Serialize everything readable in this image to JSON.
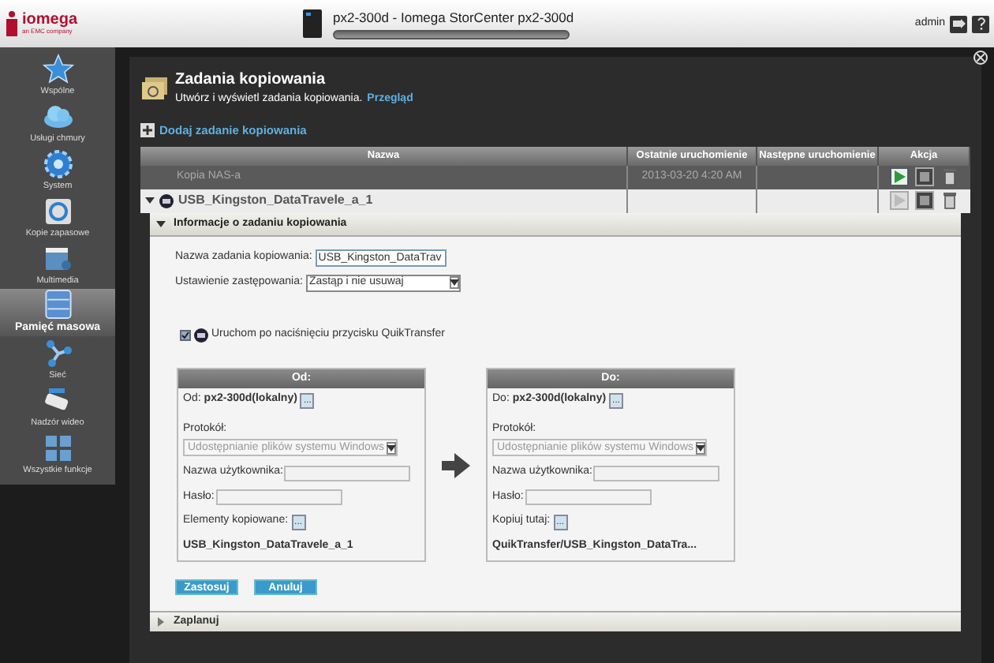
{
  "header": {
    "logo": "iomega",
    "tagline": "an EMC company",
    "device_title": "px2-300d - Iomega StorCenter px2-300d",
    "user": "admin"
  },
  "sidebar": {
    "items": [
      {
        "label": "Wspólne",
        "selected": false
      },
      {
        "label": "Usługi chmury",
        "selected": false
      },
      {
        "label": "System",
        "selected": false
      },
      {
        "label": "Kopie zapasowe",
        "selected": false
      },
      {
        "label": "Multimedia",
        "selected": false
      },
      {
        "label": "Pamięć masowa",
        "selected": true
      },
      {
        "label": "Sieć",
        "selected": false
      },
      {
        "label": "Nadzór wideo",
        "selected": false
      },
      {
        "label": "Wszystkie funkcje",
        "selected": false
      }
    ]
  },
  "page": {
    "title": "Zadania kopiowania",
    "subtitle": "Utwórz i wyświetl zadania kopiowania.",
    "link": "Przegląd",
    "add_link": "Dodaj zadanie kopiowania"
  },
  "table": {
    "columns": [
      "Nazwa",
      "Ostatnie uruchomienie",
      "Następne uruchomienie",
      "Akcja"
    ],
    "rows": [
      {
        "kind": "plain",
        "name": "Kopia NAS-a",
        "last_run": "2013-03-20 4:20 AM",
        "play_enabled": true
      },
      {
        "kind": "expandable",
        "expanded": true,
        "name": "USB_Kingston_DataTravele_a_1",
        "play_enabled": false
      }
    ]
  },
  "details": {
    "title": "Informacje o zadaniu kopiowania",
    "expanded": true,
    "name_label": "Nazwa zadania kopiowania:",
    "name_value": "USB_Kingston_DataTrav",
    "overwrite_label": "Ustawienie zastępowania:",
    "overwrite_value": "Zastąp i nie usuwaj",
    "quiktransfer": {
      "label": "Uruchom po naciśnięciu przycisku QuikTransfer",
      "checked": true
    },
    "panels": [
      {
        "header": "Od:",
        "target_label": "Od:",
        "target_value": "px2-300d(lokalny)",
        "browse": "...",
        "protocol_label": "Protokół:",
        "protocol_value": "Udostępnianie plików systemu Windows",
        "protocol_disabled": true,
        "user_label": "Nazwa użytkownika:",
        "password_label": "Hasło:",
        "items_label": "Elementy kopiowane:",
        "items_browse": "...",
        "path": "USB_Kingston_DataTravele_a_1"
      },
      {
        "header": "Do:",
        "target_label": "Do:",
        "target_value": "px2-300d(lokalny)",
        "browse": "...",
        "protocol_label": "Protokół:",
        "protocol_value": "Udostępnianie plików systemu Windows",
        "protocol_disabled": true,
        "user_label": "Nazwa użytkownika:",
        "password_label": "Hasło:",
        "items_label": "Kopiuj tutaj:",
        "items_browse": "...",
        "path": "QuikTransfer/USB_Kingston_DataTra..."
      }
    ],
    "buttons": [
      "Zastosuj",
      "Anuluj"
    ]
  },
  "schedule": {
    "title": "Zaplanuj",
    "expanded": false
  }
}
